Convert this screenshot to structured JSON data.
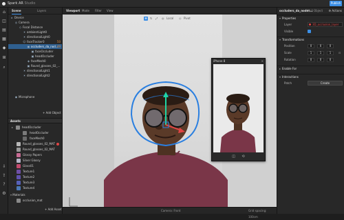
{
  "titlebar": {
    "app": "Spark AR",
    "app_suffix": "Studio",
    "publish_label": "Publish"
  },
  "toolbar": {
    "icons": [
      "home-icon",
      "camera-icon",
      "assets-icon",
      "scene-icon",
      "layers-icon",
      "patch-icon",
      "search-icon",
      "import-icon",
      "share-icon",
      "help-icon",
      "settings-icon"
    ]
  },
  "scene": {
    "tabs": [
      "Scene",
      "Layers"
    ],
    "items": [
      {
        "label": "Device",
        "icon": "▸"
      },
      {
        "label": "Camera",
        "icon": "◎"
      },
      {
        "label": "Focal Distance",
        "icon": "◇"
      },
      {
        "label": "ambientLight0",
        "icon": "☀"
      },
      {
        "label": "directionalLight0",
        "icon": "☀"
      },
      {
        "label": "faceTracker0",
        "icon": "☺",
        "count": "50"
      },
      {
        "label": "occluders_da_nod...",
        "icon": "▣",
        "count": "49"
      },
      {
        "label": "faceOccluder",
        "icon": "▣"
      },
      {
        "label": "headOccluder",
        "icon": "▣"
      },
      {
        "label": "faceMesh0",
        "icon": "◈"
      },
      {
        "label": "Round_glasses_02_...",
        "icon": "▣"
      },
      {
        "label": "directionalLight1",
        "icon": "☀"
      },
      {
        "label": "directionalLight2",
        "icon": "☀"
      },
      {
        "label": "Microphone",
        "icon": "◉"
      }
    ],
    "add_object": "+ Add Object"
  },
  "assets": {
    "header": "Assets",
    "items": [
      {
        "label": "headOccluder",
        "color": "#8a8a8a"
      },
      {
        "label": "headOccluder",
        "color": "#7a7a7a"
      },
      {
        "label": "faceMesh0",
        "color": "#6a6a6a"
      },
      {
        "label": "Round_glasses_02_MAT",
        "color": "#b7b7b7",
        "warn": true
      },
      {
        "label": "Round_glasses_02_MAT",
        "color": "#999999"
      },
      {
        "label": "Glossy Papers",
        "color": "#c76b93"
      },
      {
        "label": "Silver Glossy",
        "color": "#b6b6c8"
      },
      {
        "label": "Glass01",
        "color": "#c24a6e"
      },
      {
        "label": "Texture1",
        "color": "#6f4fa8"
      },
      {
        "label": "Texture2",
        "color": "#6052b0"
      },
      {
        "label": "Texture3",
        "color": "#5660b8"
      },
      {
        "label": "Texture4",
        "color": "#4a78b5"
      }
    ],
    "materials_hdr": "Materials",
    "materials_item": "occlusion_mat",
    "add_asset": "+ Add Asset"
  },
  "viewport": {
    "tabs": [
      "Viewport",
      "Mode",
      "Filter",
      "View"
    ],
    "tools": [
      "Local",
      "Pivot"
    ],
    "status_left": "",
    "status_center": "Camera: Front",
    "status_right": "Grid spacing: 100cm"
  },
  "simulator": {
    "device": "iPhone 8",
    "close": "✕"
  },
  "inspector": {
    "name": "occluders_da_noder...",
    "type": "Null Object",
    "actions": "Actions",
    "sections": {
      "properties": "Properties",
      "transformations": "Transformations",
      "enable_for": "Enable For",
      "interactions": "Interactions"
    },
    "layer_label": "Layer",
    "layer_value": "3D_occlusion_layer",
    "visible_label": "Visible",
    "position_label": "Position",
    "position": [
      "0",
      "0",
      "0"
    ],
    "scale_label": "Scale",
    "scale": [
      "1",
      "1",
      "1"
    ],
    "rotation_label": "Rotation",
    "rotation": [
      "0",
      "0",
      "0"
    ],
    "patch_label": "Patch",
    "create_label": "Create"
  },
  "colors": {
    "accent": "#3c8fe6",
    "warn": "#e04545",
    "shirt": "#7a3648",
    "skin": "#5a3a28"
  }
}
